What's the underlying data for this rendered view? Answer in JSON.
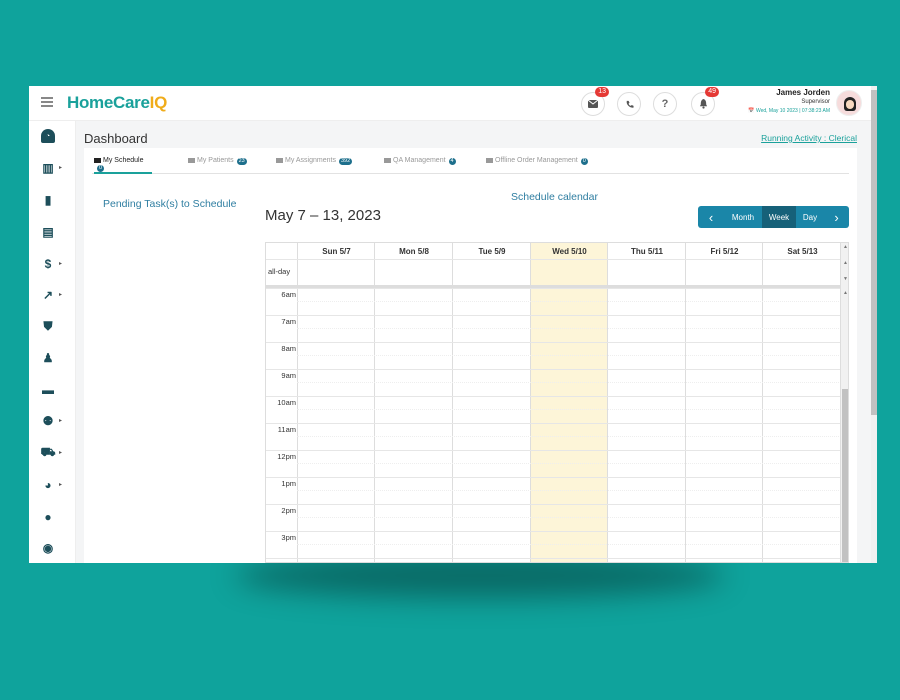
{
  "header": {
    "logo_part1": "HomeCare",
    "logo_part2": "IQ",
    "mail_badge": "13",
    "bell_badge": "49",
    "phone_icon": "phone-icon",
    "help_label": "?",
    "user_name": "James Jorden",
    "user_role": "Supervisor",
    "user_date": "📅 Wed, May 10 2023  |  07:38:23 AM"
  },
  "page": {
    "title": "Dashboard",
    "running_activity": "Running Activity : Clerical"
  },
  "tabs": [
    {
      "label": "My Schedule",
      "count": "0"
    },
    {
      "label": "My Patients",
      "count": "23"
    },
    {
      "label": "My Assignments",
      "count": "392"
    },
    {
      "label": "QA Management",
      "count": "4"
    },
    {
      "label": "Offline Order Management",
      "count": "0"
    }
  ],
  "pending_title": "Pending Task(s) to Schedule",
  "calendar": {
    "title": "Schedule calendar",
    "range": "May 7 – 13, 2023",
    "prev_label": "‹",
    "next_label": "›",
    "views": [
      "Month",
      "Week",
      "Day"
    ],
    "active_view": "Week",
    "all_day_label": "all-day",
    "days": [
      "Sun 5/7",
      "Mon 5/8",
      "Tue 5/9",
      "Wed 5/10",
      "Thu 5/11",
      "Fri 5/12",
      "Sat 5/13"
    ],
    "today": "Wed 5/10",
    "hours": [
      "6am",
      "7am",
      "8am",
      "9am",
      "10am",
      "11am",
      "12pm",
      "1pm",
      "2pm",
      "3pm"
    ]
  },
  "sidebar_icons": [
    "dashboard-icon",
    "building-icon",
    "clipboard-icon",
    "checklist-icon",
    "billing-icon",
    "chart-icon",
    "shield-icon",
    "staff-icon",
    "book-icon",
    "team-icon",
    "truck-icon",
    "pie-chart-icon",
    "user-icon",
    "stopwatch-icon"
  ],
  "colors": {
    "brand_teal": "#1aa19b",
    "brand_orange": "#f0ac1a",
    "today_highlight": "#fdf5d8",
    "button_blue": "#1a86a8",
    "background": "#0fa39c"
  }
}
